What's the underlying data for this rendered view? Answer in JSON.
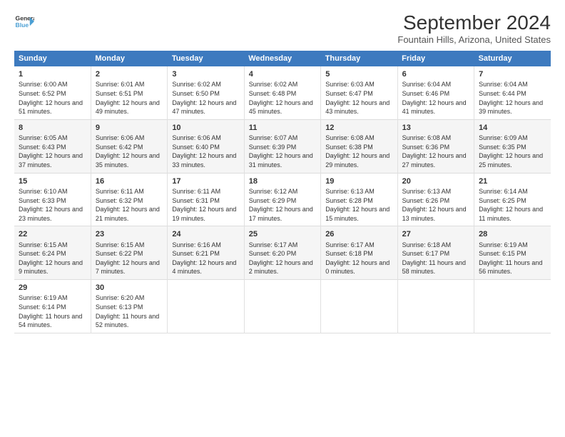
{
  "logo": {
    "line1": "General",
    "line2": "Blue",
    "arrow_color": "#4a9fd4"
  },
  "title": "September 2024",
  "subtitle": "Fountain Hills, Arizona, United States",
  "columns": [
    "Sunday",
    "Monday",
    "Tuesday",
    "Wednesday",
    "Thursday",
    "Friday",
    "Saturday"
  ],
  "weeks": [
    [
      {
        "day": "1",
        "rise": "6:00 AM",
        "set": "6:52 PM",
        "daylight": "12 hours and 51 minutes."
      },
      {
        "day": "2",
        "rise": "6:01 AM",
        "set": "6:51 PM",
        "daylight": "12 hours and 49 minutes."
      },
      {
        "day": "3",
        "rise": "6:02 AM",
        "set": "6:50 PM",
        "daylight": "12 hours and 47 minutes."
      },
      {
        "day": "4",
        "rise": "6:02 AM",
        "set": "6:48 PM",
        "daylight": "12 hours and 45 minutes."
      },
      {
        "day": "5",
        "rise": "6:03 AM",
        "set": "6:47 PM",
        "daylight": "12 hours and 43 minutes."
      },
      {
        "day": "6",
        "rise": "6:04 AM",
        "set": "6:46 PM",
        "daylight": "12 hours and 41 minutes."
      },
      {
        "day": "7",
        "rise": "6:04 AM",
        "set": "6:44 PM",
        "daylight": "12 hours and 39 minutes."
      }
    ],
    [
      {
        "day": "8",
        "rise": "6:05 AM",
        "set": "6:43 PM",
        "daylight": "12 hours and 37 minutes."
      },
      {
        "day": "9",
        "rise": "6:06 AM",
        "set": "6:42 PM",
        "daylight": "12 hours and 35 minutes."
      },
      {
        "day": "10",
        "rise": "6:06 AM",
        "set": "6:40 PM",
        "daylight": "12 hours and 33 minutes."
      },
      {
        "day": "11",
        "rise": "6:07 AM",
        "set": "6:39 PM",
        "daylight": "12 hours and 31 minutes."
      },
      {
        "day": "12",
        "rise": "6:08 AM",
        "set": "6:38 PM",
        "daylight": "12 hours and 29 minutes."
      },
      {
        "day": "13",
        "rise": "6:08 AM",
        "set": "6:36 PM",
        "daylight": "12 hours and 27 minutes."
      },
      {
        "day": "14",
        "rise": "6:09 AM",
        "set": "6:35 PM",
        "daylight": "12 hours and 25 minutes."
      }
    ],
    [
      {
        "day": "15",
        "rise": "6:10 AM",
        "set": "6:33 PM",
        "daylight": "12 hours and 23 minutes."
      },
      {
        "day": "16",
        "rise": "6:11 AM",
        "set": "6:32 PM",
        "daylight": "12 hours and 21 minutes."
      },
      {
        "day": "17",
        "rise": "6:11 AM",
        "set": "6:31 PM",
        "daylight": "12 hours and 19 minutes."
      },
      {
        "day": "18",
        "rise": "6:12 AM",
        "set": "6:29 PM",
        "daylight": "12 hours and 17 minutes."
      },
      {
        "day": "19",
        "rise": "6:13 AM",
        "set": "6:28 PM",
        "daylight": "12 hours and 15 minutes."
      },
      {
        "day": "20",
        "rise": "6:13 AM",
        "set": "6:26 PM",
        "daylight": "12 hours and 13 minutes."
      },
      {
        "day": "21",
        "rise": "6:14 AM",
        "set": "6:25 PM",
        "daylight": "12 hours and 11 minutes."
      }
    ],
    [
      {
        "day": "22",
        "rise": "6:15 AM",
        "set": "6:24 PM",
        "daylight": "12 hours and 9 minutes."
      },
      {
        "day": "23",
        "rise": "6:15 AM",
        "set": "6:22 PM",
        "daylight": "12 hours and 7 minutes."
      },
      {
        "day": "24",
        "rise": "6:16 AM",
        "set": "6:21 PM",
        "daylight": "12 hours and 4 minutes."
      },
      {
        "day": "25",
        "rise": "6:17 AM",
        "set": "6:20 PM",
        "daylight": "12 hours and 2 minutes."
      },
      {
        "day": "26",
        "rise": "6:17 AM",
        "set": "6:18 PM",
        "daylight": "12 hours and 0 minutes."
      },
      {
        "day": "27",
        "rise": "6:18 AM",
        "set": "6:17 PM",
        "daylight": "11 hours and 58 minutes."
      },
      {
        "day": "28",
        "rise": "6:19 AM",
        "set": "6:15 PM",
        "daylight": "11 hours and 56 minutes."
      }
    ],
    [
      {
        "day": "29",
        "rise": "6:19 AM",
        "set": "6:14 PM",
        "daylight": "11 hours and 54 minutes."
      },
      {
        "day": "30",
        "rise": "6:20 AM",
        "set": "6:13 PM",
        "daylight": "11 hours and 52 minutes."
      },
      null,
      null,
      null,
      null,
      null
    ]
  ]
}
